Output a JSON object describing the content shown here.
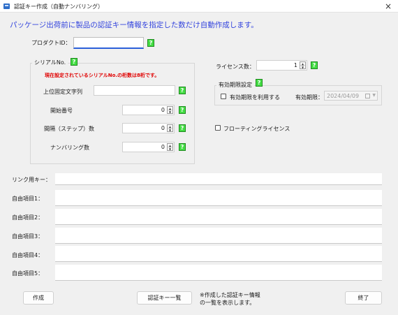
{
  "window": {
    "title": "認証キー作成（自動ナンバリング）",
    "close": "×"
  },
  "heading": "パッケージ出荷前に製品の認証キー情報を指定した数だけ自動作成します。",
  "product_id": {
    "label": "プロダクトID：",
    "value": ""
  },
  "help_mark": "?",
  "serial": {
    "group_title": "シリアルNo.",
    "warning": "現在設定されているシリアルNo.の桁数は8桁です。",
    "prefix_label": "上位固定文字列",
    "prefix_value": "",
    "start_label": "開始番号",
    "start_value": "0",
    "step_label": "間隔（ステップ）数",
    "step_value": "0",
    "digits_label": "ナンバリング数",
    "digits_value": "0"
  },
  "license": {
    "label": "ライセンス数：",
    "value": "1"
  },
  "expiry": {
    "group_title": "有効期限設定",
    "use_label": "有効期限を利用する",
    "use_checked": false,
    "date_label": "有効期限：",
    "date_value": "2024/04/09"
  },
  "floating": {
    "label": "フローティングライセンス",
    "checked": false
  },
  "fields": [
    {
      "label": "リンク用キー：",
      "value": ""
    },
    {
      "label": "自由項目1：",
      "value": ""
    },
    {
      "label": "自由項目2：",
      "value": ""
    },
    {
      "label": "自由項目3：",
      "value": ""
    },
    {
      "label": "自由項目4：",
      "value": ""
    },
    {
      "label": "自由項目5：",
      "value": ""
    }
  ],
  "buttons": {
    "create": "作成",
    "list": "認証キー一覧",
    "close": "終了"
  },
  "note_line1": "※作成した認証キー情報",
  "note_line2": "の一覧を表示します。",
  "icons": {
    "app": "app-icon",
    "close": "close-icon",
    "help": "help-icon",
    "calendar": "calendar-icon",
    "spin_up": "up-arrow-icon",
    "spin_down": "down-arrow-icon"
  },
  "colors": {
    "heading": "#3344dd",
    "warning": "#e00000",
    "help_bg": "#44dd44",
    "focus": "#2b5fd9"
  }
}
